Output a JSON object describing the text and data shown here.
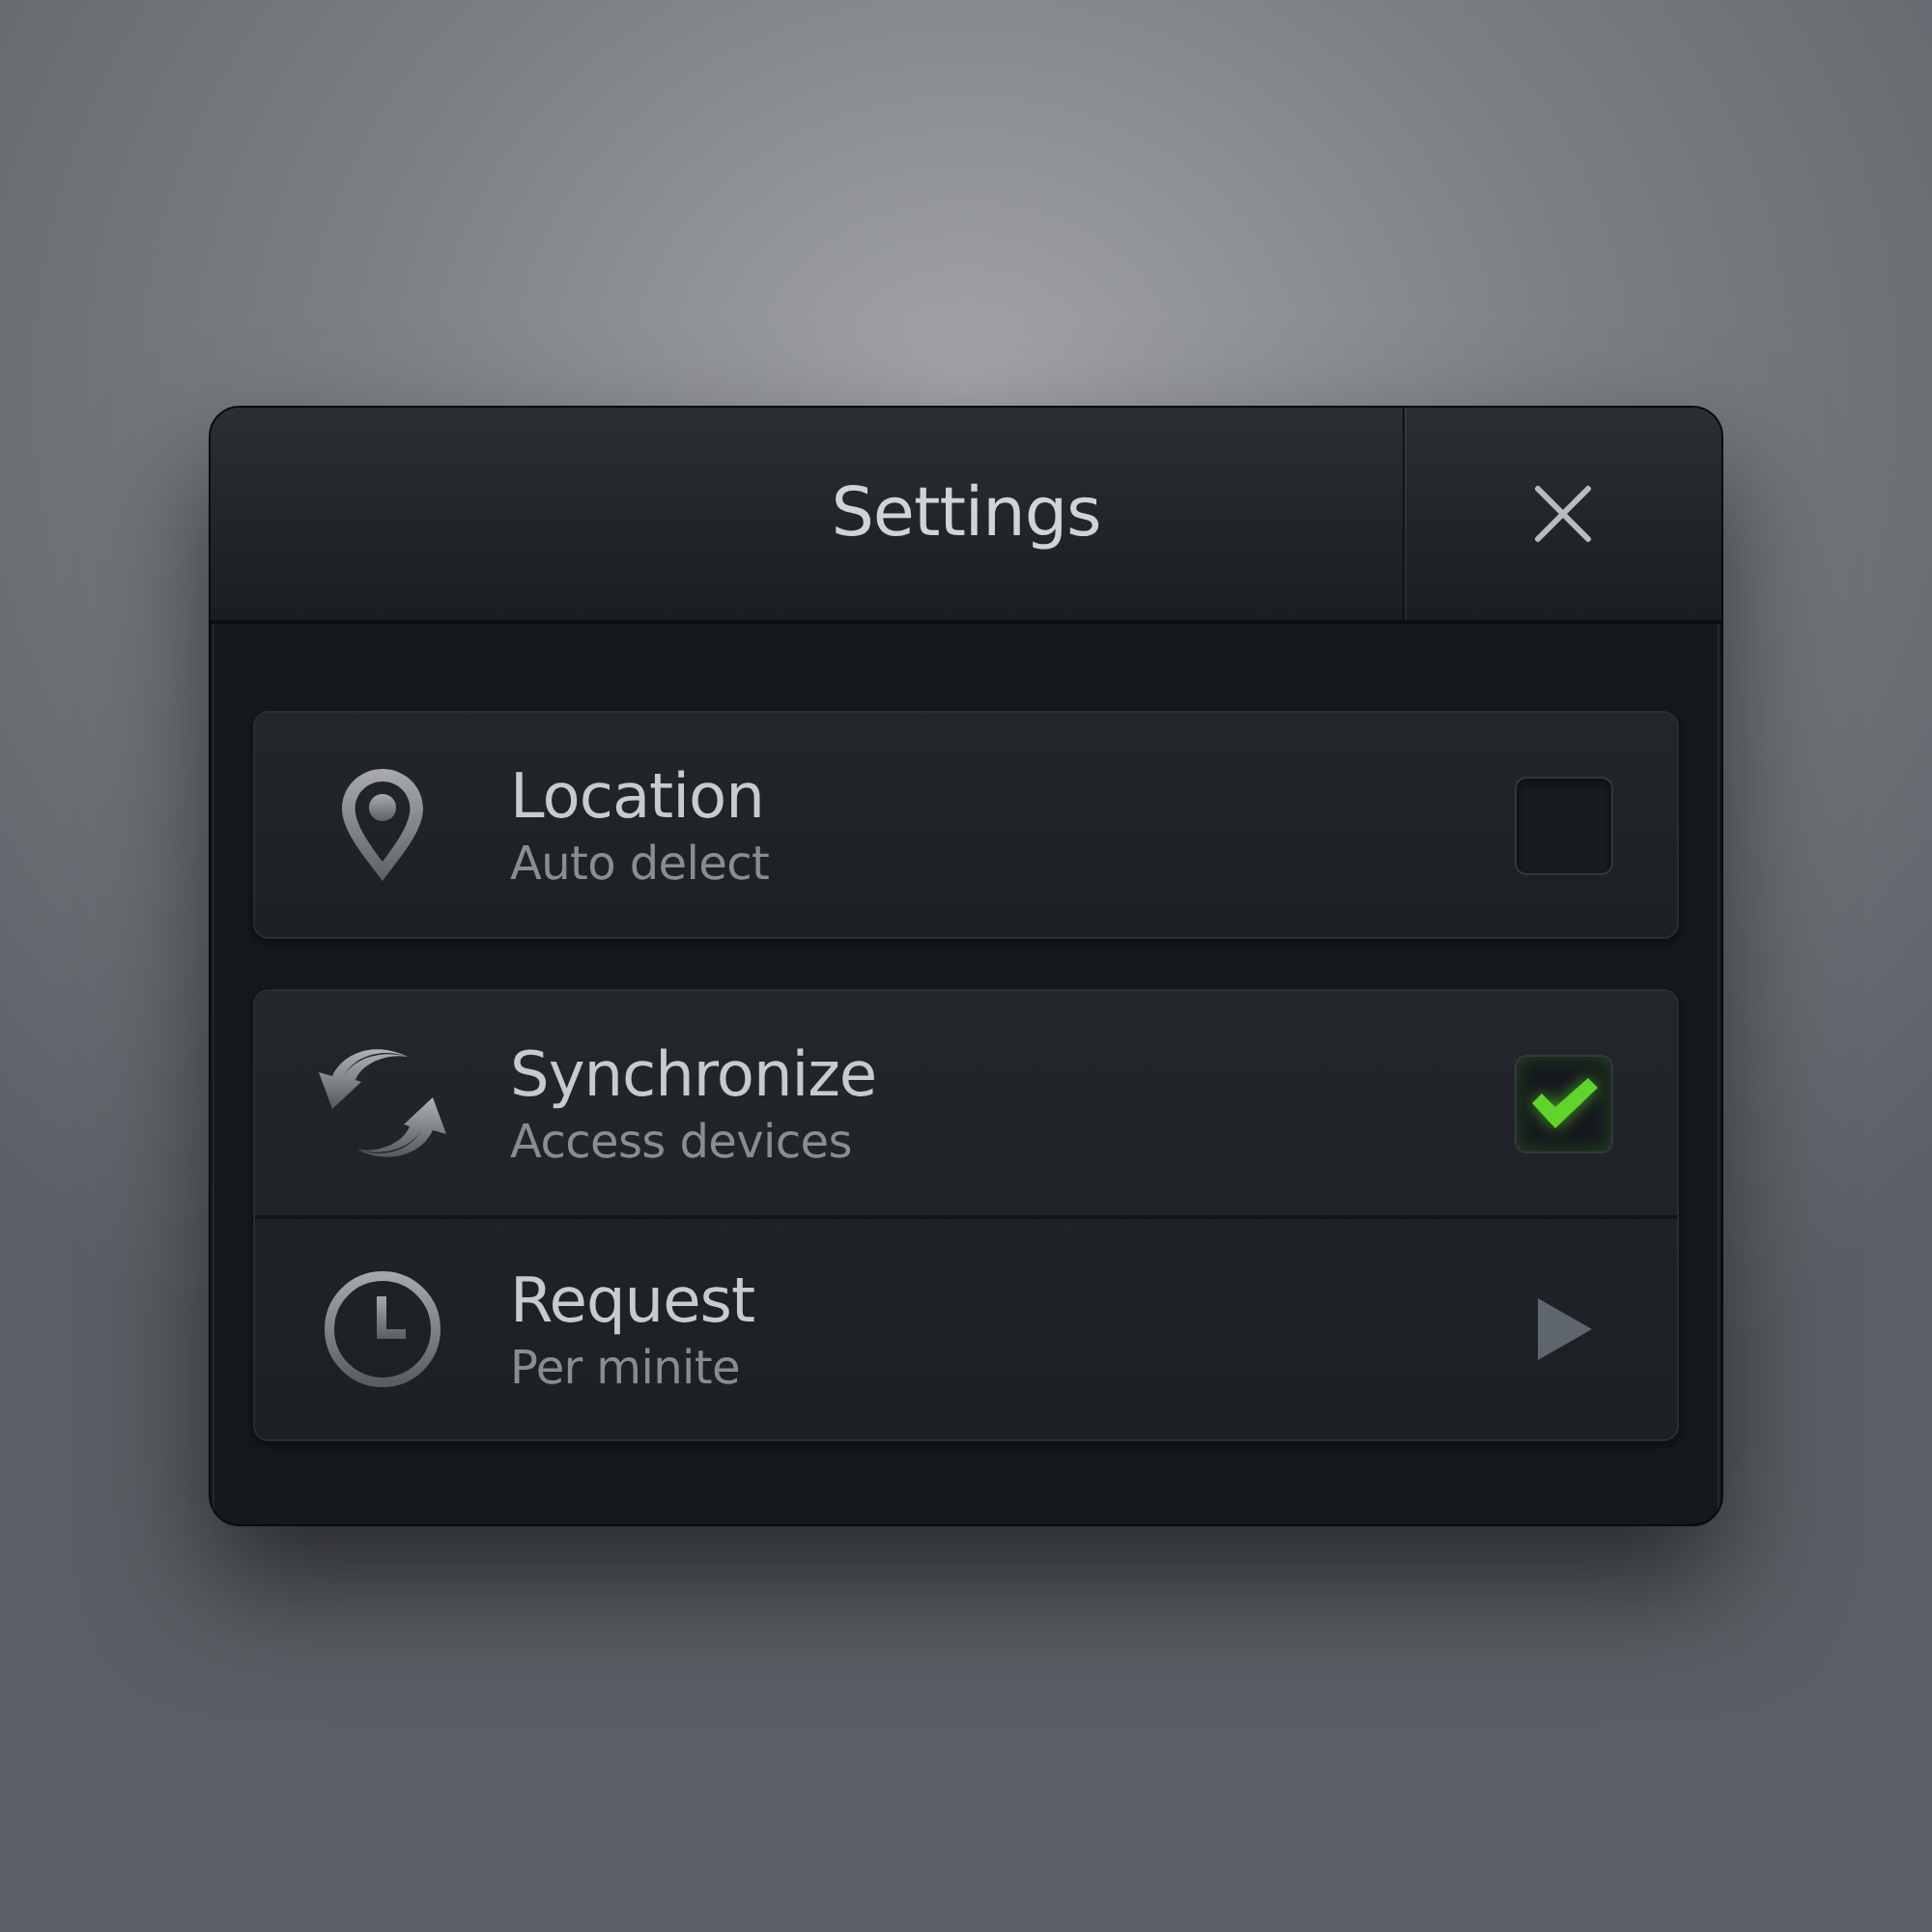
{
  "window": {
    "title": "Settings"
  },
  "groups": [
    {
      "items": [
        {
          "kind": "checkbox",
          "title": "Location",
          "subtitle": "Auto delect",
          "checked": false
        }
      ]
    },
    {
      "items": [
        {
          "kind": "checkbox",
          "title": "Synchronize",
          "subtitle": "Access devices",
          "checked": true
        },
        {
          "kind": "disclosure",
          "title": "Request",
          "subtitle": "Per minite"
        }
      ]
    }
  ]
}
